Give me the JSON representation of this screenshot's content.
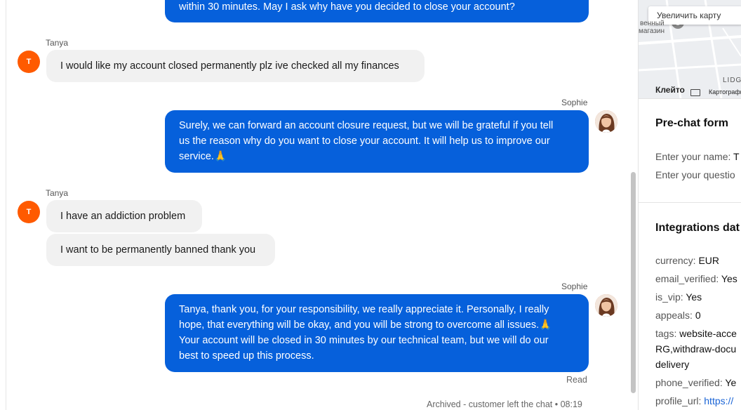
{
  "messages": {
    "m1_text": "within 30 minutes. May I ask why have you decided to close your account?",
    "m2_author": "Tanya",
    "m2_avatar": "T",
    "m2_text": "I would like my account closed permanently plz ive checked all my finances",
    "m3_author": "Sophie",
    "m3_line1": "Surely, we can forward an account closure request, but we will be grateful if you tell",
    "m3_line2": "us the reason why do you want to close your account. It will help us to improve our",
    "m3_line3": "service.🙏",
    "m4_author": "Tanya",
    "m4_avatar": "T",
    "m4_text": "I have an addiction problem",
    "m5_text": "I want to be permanently banned thank you",
    "m6_author": "Sophie",
    "m6_line1": "Tanya, thank you, for your responsibility, we really appreciate it. Personally, I really",
    "m6_line2": "hope, that everything will be okay, and you will be strong to overcome all issues.🙏",
    "m6_line3": "Your account will be closed in 30 minutes by our technical team, but we will do our",
    "m6_line4": "best to speed up this process.",
    "read_status": "Read",
    "archived_status": "Archived - customer left the chat • 08:19"
  },
  "map": {
    "enlarge_button": "Увеличить карту",
    "label_shop_1": "венный",
    "label_shop_2": "магазин",
    "label_lidge": "LIDGE",
    "city": "Клейто",
    "footer": "Картографи"
  },
  "prechat": {
    "title": "Pre-chat form",
    "name_label": "Enter your name:",
    "name_value": "T",
    "question_label": "Enter your questio"
  },
  "integrations": {
    "title": "Integrations dat",
    "currency_key": "currency:",
    "currency_val": "EUR",
    "email_key": "email_verified:",
    "email_val": "Yes",
    "vip_key": "is_vip:",
    "vip_val": "Yes",
    "appeals_key": "appeals:",
    "appeals_val": "0",
    "tags_key": "tags:",
    "tags_val1": "website-acce",
    "tags_val2": "RG,withdraw-docu",
    "tags_val3": "delivery",
    "phone_key": "phone_verified:",
    "phone_val": "Ye",
    "profile_key": "profile_url:",
    "profile_val": "https://"
  }
}
